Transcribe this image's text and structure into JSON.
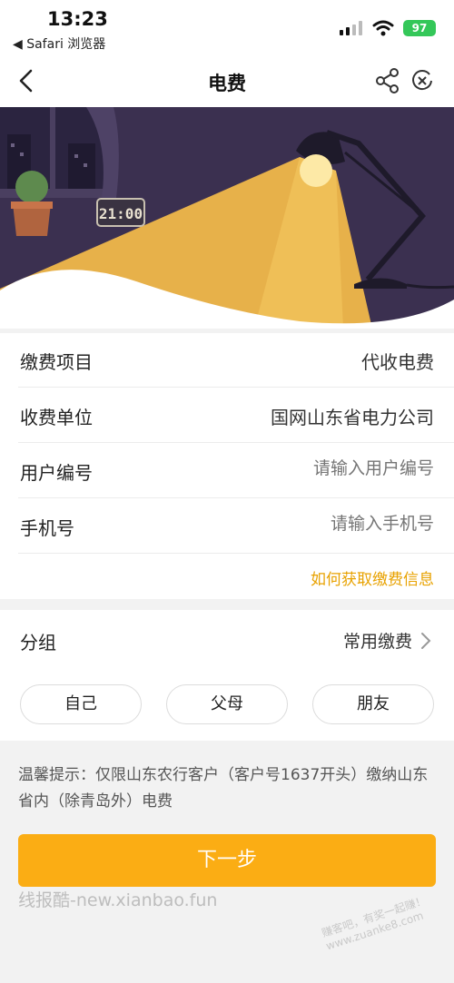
{
  "status_bar": {
    "time": "13:23",
    "back_app": "◀ Safari 浏览器",
    "battery": "97"
  },
  "nav": {
    "title": "电费"
  },
  "banner": {
    "clock_text": "21:00"
  },
  "form": {
    "rows": [
      {
        "label": "缴费项目",
        "value": "代收电费"
      },
      {
        "label": "收费单位",
        "value": "国网山东省电力公司"
      },
      {
        "label": "用户编号",
        "placeholder": "请输入用户编号"
      },
      {
        "label": "手机号",
        "placeholder": "请输入手机号"
      }
    ],
    "help_link": "如何获取缴费信息"
  },
  "group": {
    "label": "分组",
    "value": "常用缴费",
    "chips": [
      "自己",
      "父母",
      "朋友"
    ]
  },
  "tip": "温馨提示：仅限山东农行客户（客户号1637开头）缴纳山东省内（除青岛外）电费",
  "next_button": "下一步",
  "watermarks": {
    "site": "线报酷-new.xianbao.fun",
    "corner": "赚客吧，有奖一起赚！ www.zuanke8.com"
  },
  "colors": {
    "accent": "#fbad14",
    "link": "#e8a200",
    "banner_bg": "#3a2f4c",
    "lamp_light": "#f0b84a"
  }
}
